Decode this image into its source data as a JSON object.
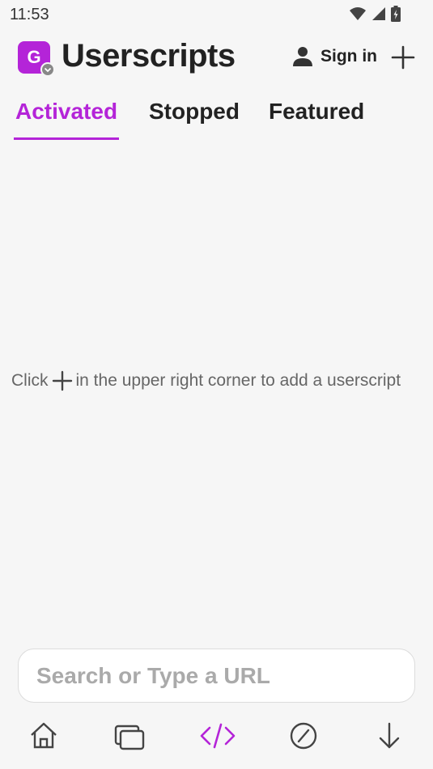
{
  "status_bar": {
    "time": "11:53",
    "icons": [
      "wifi-icon",
      "cell-signal-icon",
      "battery-charging-icon"
    ]
  },
  "header": {
    "logo_letter": "G",
    "title": "Userscripts",
    "sign_in_label": "Sign in",
    "icons": [
      "user-icon",
      "plus-icon"
    ]
  },
  "tabs": [
    {
      "label": "Activated",
      "active": true
    },
    {
      "label": "Stopped",
      "active": false
    },
    {
      "label": "Featured",
      "active": false
    }
  ],
  "empty_state": {
    "before_icon": "Click",
    "after_icon": "in the upper right corner to add a userscript"
  },
  "search": {
    "placeholder": "Search or Type a URL",
    "value": ""
  },
  "bottom_nav": [
    {
      "icon": "home-icon"
    },
    {
      "icon": "tabs-icon"
    },
    {
      "icon": "code-icon",
      "active": true
    },
    {
      "icon": "block-icon"
    },
    {
      "icon": "download-icon"
    }
  ],
  "colors": {
    "accent": "#b424d8",
    "background": "#f6f6f6",
    "text": "#222222",
    "muted": "#666666"
  }
}
